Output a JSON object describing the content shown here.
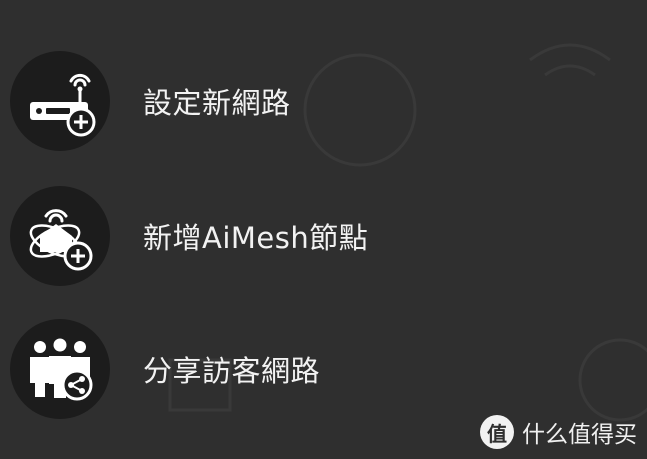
{
  "menu": {
    "items": [
      {
        "label": "設定新網路",
        "icon": "router-add-icon"
      },
      {
        "label": "新增AiMesh節點",
        "icon": "aimesh-add-icon"
      },
      {
        "label": "分享訪客網路",
        "icon": "guest-share-icon"
      }
    ]
  },
  "watermark": {
    "logo_glyph": "值",
    "text": "什么值得买"
  },
  "colors": {
    "background": "#2f2f2f",
    "icon_circle": "#1c1c1c",
    "text": "#f2f2f2"
  }
}
